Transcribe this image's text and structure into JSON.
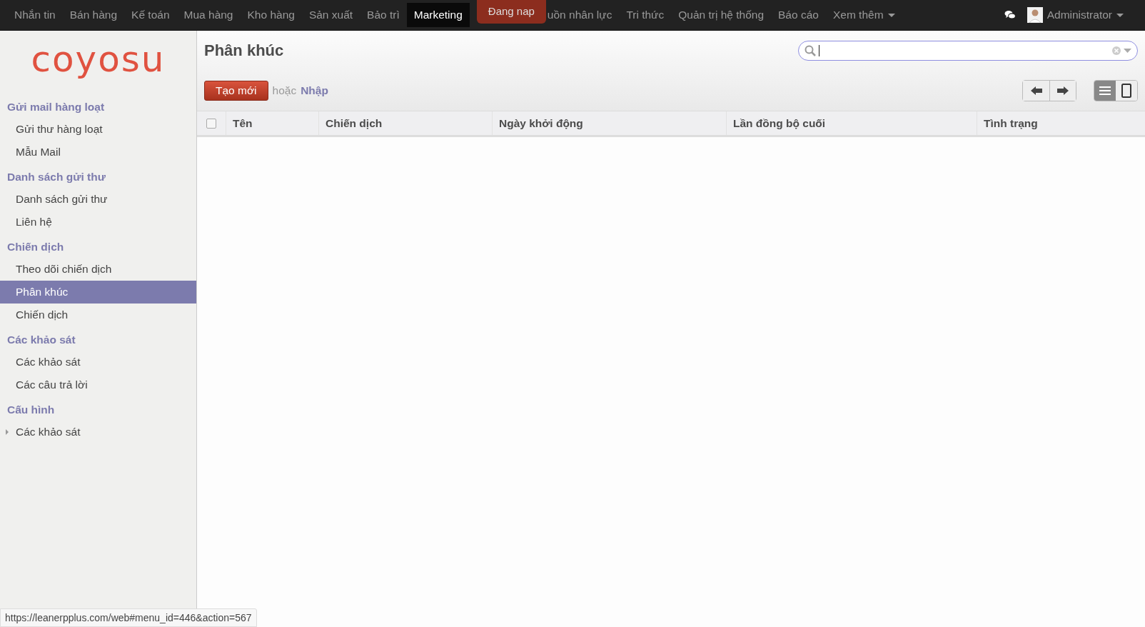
{
  "top_menu": [
    {
      "label": "Nhắn tin",
      "selected": false
    },
    {
      "label": "Bán hàng",
      "selected": false
    },
    {
      "label": "Kế toán",
      "selected": false
    },
    {
      "label": "Mua hàng",
      "selected": false
    },
    {
      "label": "Kho hàng",
      "selected": false
    },
    {
      "label": "Sản xuất",
      "selected": false
    },
    {
      "label": "Bảo trì",
      "selected": false
    },
    {
      "label": "Marketing",
      "selected": true
    },
    {
      "label": "uồn nhân lực",
      "selected": false,
      "covered_by_loading": true
    },
    {
      "label": "Tri thức",
      "selected": false
    },
    {
      "label": "Quản trị hệ thống",
      "selected": false
    },
    {
      "label": "Báo cáo",
      "selected": false
    },
    {
      "label": "Xem thêm",
      "selected": false,
      "dropdown": true
    }
  ],
  "loading_badge": "Đang nap",
  "user": {
    "name": "Administrator"
  },
  "logo": "coyosu",
  "sidebar": [
    {
      "heading": "Gửi mail hàng loạt",
      "items": [
        {
          "label": "Gửi thư hàng loạt",
          "selected": false
        },
        {
          "label": "Mẫu Mail",
          "selected": false
        }
      ]
    },
    {
      "heading": "Danh sách gửi thư",
      "items": [
        {
          "label": "Danh sách gửi thư",
          "selected": false
        },
        {
          "label": "Liên hệ",
          "selected": false
        }
      ]
    },
    {
      "heading": "Chiến dịch",
      "items": [
        {
          "label": "Theo dõi chiến dịch",
          "selected": false
        },
        {
          "label": "Phân khúc",
          "selected": true
        },
        {
          "label": "Chiến dịch",
          "selected": false
        }
      ]
    },
    {
      "heading": "Các khảo sát",
      "items": [
        {
          "label": "Các khảo sát",
          "selected": false
        },
        {
          "label": "Các câu trả lời",
          "selected": false
        }
      ]
    },
    {
      "heading": "Cấu hình",
      "items": [
        {
          "label": "Các khảo sát",
          "selected": false,
          "expanded": false
        }
      ]
    }
  ],
  "page_title": "Phân khúc",
  "create_button": "Tạo mới",
  "or_text": "hoặc",
  "import_link": "Nhập",
  "view_modes": [
    {
      "kind": "list",
      "selected": true
    },
    {
      "kind": "form",
      "selected": false
    }
  ],
  "table": {
    "all_checked": false,
    "columns": [
      "Tên",
      "Chiến dịch",
      "Ngày khởi động",
      "Lần đồng bộ cuối",
      "Tình trạng"
    ]
  },
  "status_url": "https://leanerpplus.com/web#menu_id=446&action=567"
}
